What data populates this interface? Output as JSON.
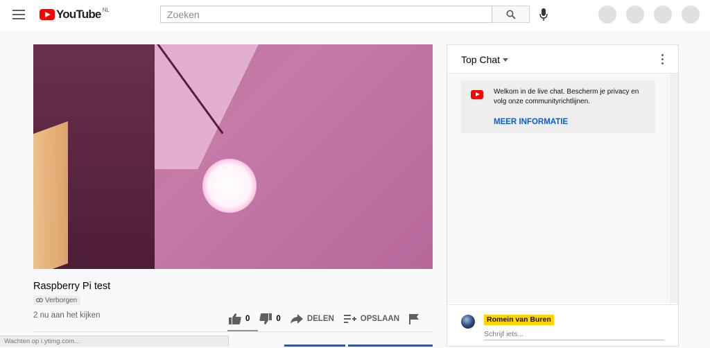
{
  "header": {
    "logo_text": "YouTube",
    "country_code": "NL",
    "search_placeholder": "Zoeken"
  },
  "video": {
    "title": "Raspberry Pi test",
    "visibility": "Verborgen",
    "viewers": "2 nu aan het kijken",
    "likes": "0",
    "dislikes": "0",
    "share_label": "DELEN",
    "save_label": "OPSLAAN"
  },
  "chat": {
    "title": "Top Chat",
    "welcome_text": "Welkom in de live chat. Bescherm je privacy en volg onze communityrichtlijnen.",
    "welcome_link": "MEER INFORMATIE",
    "author": "Romein van Buren",
    "input_placeholder": "Schrijf iets..."
  },
  "status_bar": "Wachten op i.ytimg.com...",
  "colors": {
    "brand": "#ff0000",
    "link": "#065fd4",
    "author_chip": "#ffd600"
  }
}
